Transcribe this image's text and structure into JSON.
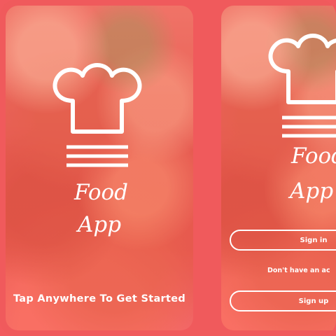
{
  "screen1": {
    "title_line1": "Food",
    "title_line2": "App",
    "tagline": "Tap Anywhere To Get Started"
  },
  "screen2": {
    "title_line1": "Food",
    "title_line2": "App",
    "signin_label": "Sign in",
    "no_account_text": "Don't have an ac",
    "signup_label": "Sign up"
  },
  "colors": {
    "background": "#f25a5e",
    "text": "#ffffff"
  },
  "icons": [
    "chef-hat-icon"
  ]
}
